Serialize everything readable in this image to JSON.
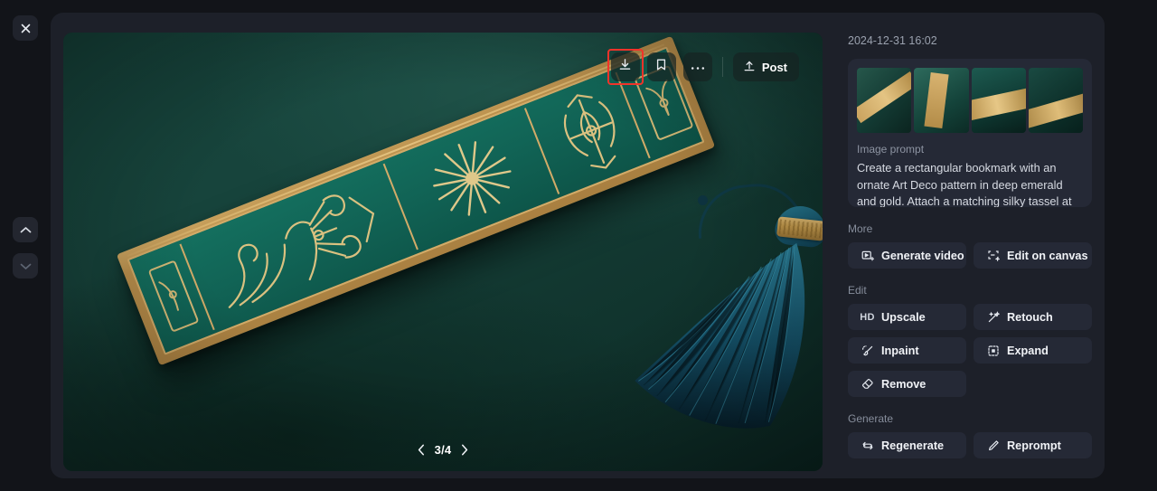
{
  "left_rail": {
    "close_icon": "close-icon",
    "prev_icon": "chevron-up-icon",
    "next_icon": "chevron-down-icon"
  },
  "toolbar": {
    "download_icon": "download-icon",
    "bookmark_icon": "bookmark-icon",
    "more_icon": "ellipsis-icon",
    "post_icon": "upload-icon",
    "post_label": "Post",
    "highlight_color": "#f2332a",
    "highlighted_button": "download-button"
  },
  "pager": {
    "prev_icon": "chevron-left-icon",
    "label": "3/4",
    "next_icon": "chevron-right-icon",
    "current": 3,
    "total": 4
  },
  "sidebar": {
    "timestamp": "2024-12-31 16:02",
    "thumbnails": [
      {
        "alt": "bookmark-thumbnail-1"
      },
      {
        "alt": "bookmark-thumbnail-2"
      },
      {
        "alt": "bookmark-thumbnail-3"
      },
      {
        "alt": "bookmark-thumbnail-4"
      }
    ],
    "prompt_label": "Image prompt",
    "prompt_text": "Create a rectangular bookmark with an ornate Art Deco pattern in deep emerald and gold. Attach a matching silky tassel at the top, possibly embellished with small beads or charms. The finished piece",
    "sections": [
      {
        "label": "More",
        "actions": [
          {
            "label": "Generate video",
            "icon": "video-frame-icon"
          },
          {
            "label": "Edit on canvas",
            "icon": "canvas-crop-icon"
          }
        ]
      },
      {
        "label": "Edit",
        "actions": [
          {
            "label": "Upscale",
            "icon": "hd-icon"
          },
          {
            "label": "Retouch",
            "icon": "magic-wand-icon"
          },
          {
            "label": "Inpaint",
            "icon": "brush-icon"
          },
          {
            "label": "Expand",
            "icon": "expand-icon"
          },
          {
            "label": "Remove",
            "icon": "eraser-icon"
          }
        ]
      },
      {
        "label": "Generate",
        "actions": [
          {
            "label": "Regenerate",
            "icon": "refresh-icon"
          },
          {
            "label": "Reprompt",
            "icon": "pencil-icon"
          }
        ]
      }
    ]
  },
  "colors": {
    "page_bg": "#121419",
    "panel_bg": "#1d2029",
    "card_bg": "#252936",
    "text_primary": "#f0f2f6",
    "text_muted": "#8d94a2",
    "accent_red": "#f2332a"
  }
}
